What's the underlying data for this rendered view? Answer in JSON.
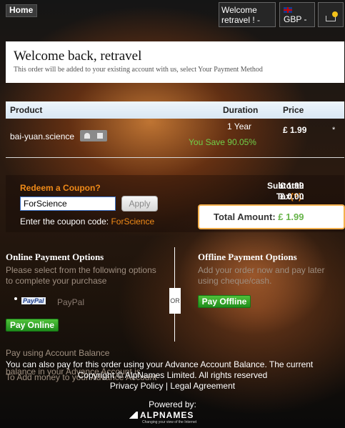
{
  "nav": {
    "home": "Home",
    "welcome_line1": "Welcome",
    "welcome_line2": "retravel ! -",
    "currency": "GBP -",
    "cart_icon": "shopping-cart"
  },
  "welcome": {
    "title": "Welcome back, retravel",
    "subtitle": "This order will be added to your existing account with us, select Your Payment Method"
  },
  "table": {
    "headers": {
      "product": "Product",
      "duration": "Duration",
      "price": "Price"
    },
    "row": {
      "domain": "bai-yuan.science",
      "duration": "1 Year",
      "savings": "You Save 90.05%",
      "price": "£ 1.99",
      "remove": "*"
    }
  },
  "coupon": {
    "title": "Redeem a Coupon?",
    "input_value": "ForScience",
    "apply_label": "Apply",
    "hint_prefix": "Enter the coupon code:",
    "hint_code": "ForScience"
  },
  "totals": {
    "subtotal_label": "Subtotal:",
    "subtotal_value": "£ 1.99",
    "tax_label": "Tax",
    "tax_help": "(?)",
    "tax_colon": ":",
    "tax_value": "£ 0.00",
    "total_label": "Total Amount:",
    "total_value": "£ 1.99"
  },
  "online": {
    "title": "Online Payment Options",
    "text_line1": "Please select from the following options",
    "text_line2": "to complete your purchase",
    "paypal_logo": "PayPal",
    "paypal_label": "PayPal",
    "button": "Pay Online"
  },
  "divider": {
    "or": "OR"
  },
  "offline": {
    "title": "Offline Payment Options",
    "text_line1": "Add your order now and pay later",
    "text_line2": "using cheque/cash.",
    "button": "Pay Offline"
  },
  "account": {
    "heading": "Pay using Account Balance",
    "line1": "You can also pay for this order using your Advance Account Balance. The current",
    "line2": "balance in your Advance Account is",
    "line3": "To Add money to your Advance Account"
  },
  "footer": {
    "copyright": "Copyright © AlpNames Limited. All rights reserved",
    "privacy": "Privacy Policy",
    "separator": " | ",
    "legal": "Legal Agreement",
    "powered_by": "Powered by:",
    "logo_name": "ALPNAMES",
    "logo_tagline": "Changing your view of the Internet"
  }
}
